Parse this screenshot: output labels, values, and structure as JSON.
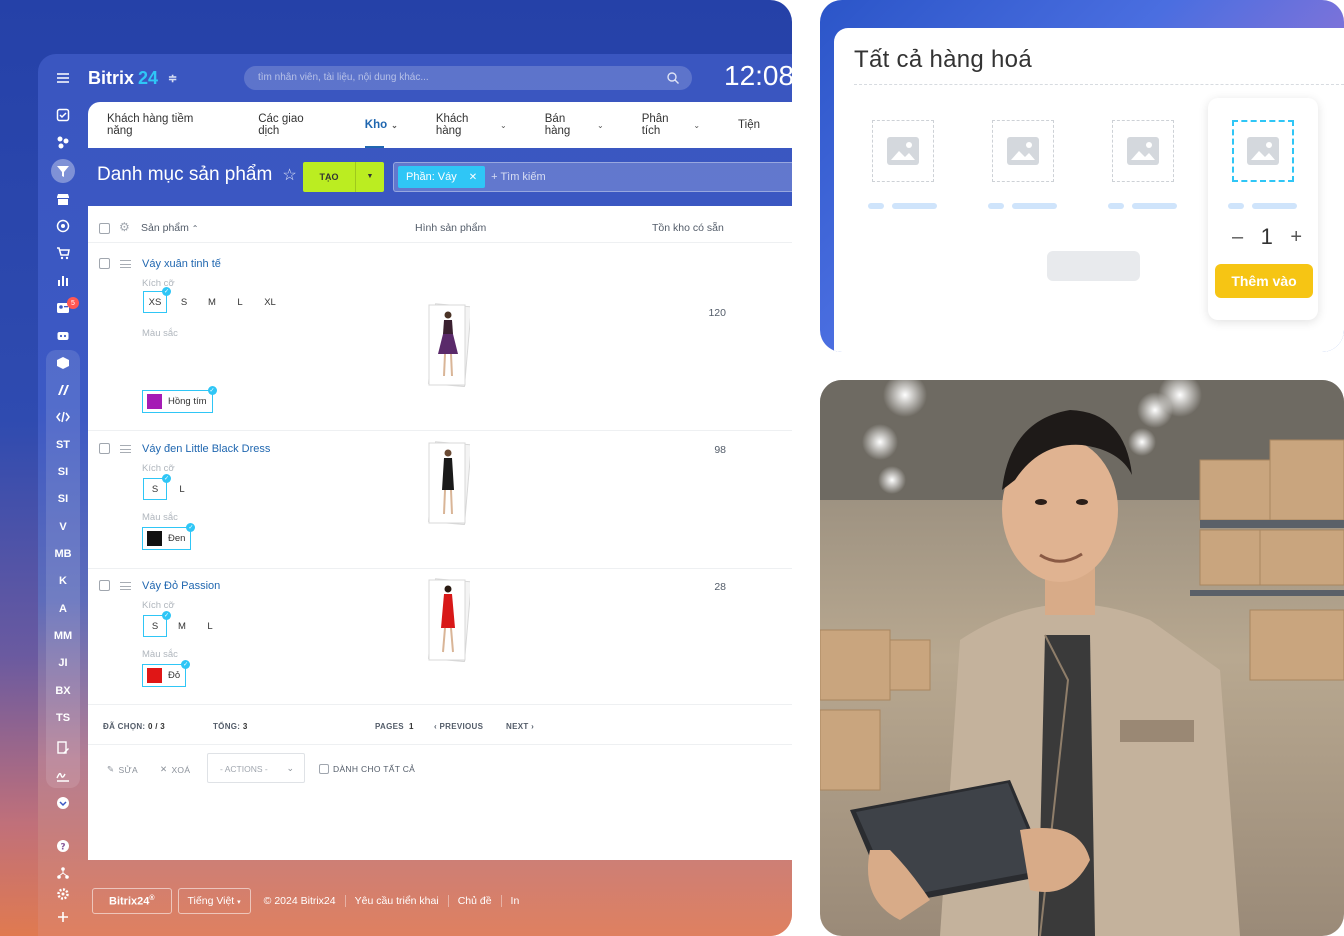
{
  "topbar": {
    "logo_text": "Bitrix",
    "logo_num": "24",
    "search_placeholder": "tìm nhân viên, tài liệu, nội dung khác...",
    "clock": "12:08"
  },
  "sidebar": {
    "letter_items": [
      "ST",
      "SI",
      "SI",
      "V",
      "MB",
      "K",
      "A",
      "MM",
      "JI",
      "BX",
      "TS"
    ],
    "badge_count": "5"
  },
  "nav": {
    "items": [
      {
        "label": "Khách hàng tiềm năng",
        "dropdown": false
      },
      {
        "label": "Các giao dịch",
        "dropdown": false
      },
      {
        "label": "Kho",
        "dropdown": true,
        "active": true
      },
      {
        "label": "Khách hàng",
        "dropdown": true
      },
      {
        "label": "Bán hàng",
        "dropdown": true
      },
      {
        "label": "Phân tích",
        "dropdown": true
      },
      {
        "label": "Tiện",
        "dropdown": false
      }
    ]
  },
  "page": {
    "title": "Danh mục sản phẩm",
    "create_label": "TẠO",
    "filter_tag": "Phần: Váy",
    "filter_search": "+ Tìm kiếm"
  },
  "table": {
    "headers": {
      "product": "Sản phẩm",
      "image": "Hình sản phẩm",
      "stock": "Tồn kho có sẵn"
    },
    "size_label": "Kích cỡ",
    "color_label": "Màu sắc",
    "rows": [
      {
        "name": "Váy xuân tinh tế",
        "sizes": [
          "XS",
          "S",
          "M",
          "L",
          "XL"
        ],
        "selected_size": "XS",
        "color": "Hồng tím",
        "color_hex": "#a51bb5",
        "stock": "120",
        "dress_color": "#5a2a6a"
      },
      {
        "name": "Váy đen Little Black Dress",
        "sizes": [
          "S",
          "L"
        ],
        "selected_size": "S",
        "color": "Đen",
        "color_hex": "#111111",
        "stock": "98",
        "dress_color": "#1a1a1a"
      },
      {
        "name": "Váy Đỏ Passion",
        "sizes": [
          "S",
          "M",
          "L"
        ],
        "selected_size": "S",
        "color": "Đỏ",
        "color_hex": "#e01616",
        "stock": "28",
        "dress_color": "#d81818"
      }
    ],
    "footer": {
      "selected_label": "ĐÃ CHỌN:",
      "selected_value": "0 / 3",
      "total_label": "TỔNG:",
      "total_value": "3",
      "pages_label": "PAGES",
      "pages_value": "1",
      "prev": "PREVIOUS",
      "next": "NEXT"
    },
    "actions": {
      "edit": "SỬA",
      "delete": "XOÁ",
      "select": "- ACTIONS -",
      "for_all": "DÀNH CHO TẤT CẢ"
    }
  },
  "bottom": {
    "brand": "Bitrix24",
    "language": "Tiếng Việt",
    "links": [
      "© 2024 Bitrix24",
      "Yêu cầu triển khai",
      "Chủ đề",
      "In"
    ]
  },
  "catalog_card": {
    "title": "Tất cả hàng hoá",
    "quantity": "1",
    "minus": "–",
    "plus": "+",
    "add_label": "Thêm vào"
  },
  "colors": {
    "accent": "#2fc6f6",
    "create_btn": "#bbed21",
    "add_btn": "#f6c514",
    "link": "#2067b0"
  }
}
